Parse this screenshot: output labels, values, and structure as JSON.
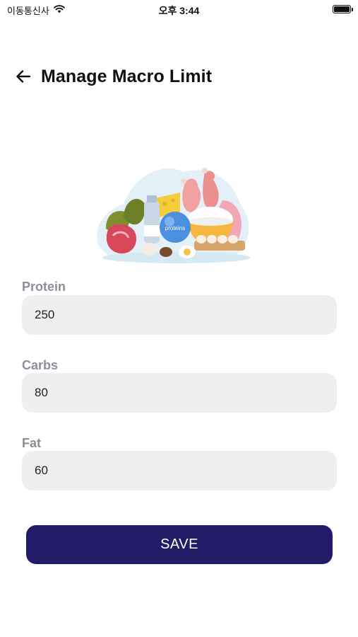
{
  "status_bar": {
    "carrier": "이동통신사",
    "time": "오후 3:44",
    "icons": [
      "wifi-icon",
      "battery-icon"
    ]
  },
  "header": {
    "back_icon": "arrow-left-icon",
    "title": "Manage Macro Limit"
  },
  "illustration": {
    "name": "food-illustration",
    "caption": "proteins"
  },
  "form": {
    "fields": [
      {
        "label": "Protein",
        "value": "250"
      },
      {
        "label": "Carbs",
        "value": "80"
      },
      {
        "label": "Fat",
        "value": "60"
      }
    ],
    "save_label": "SAVE"
  },
  "colors": {
    "primary": "#221c68",
    "input_bg": "#efefef",
    "label": "#8a8f98"
  }
}
